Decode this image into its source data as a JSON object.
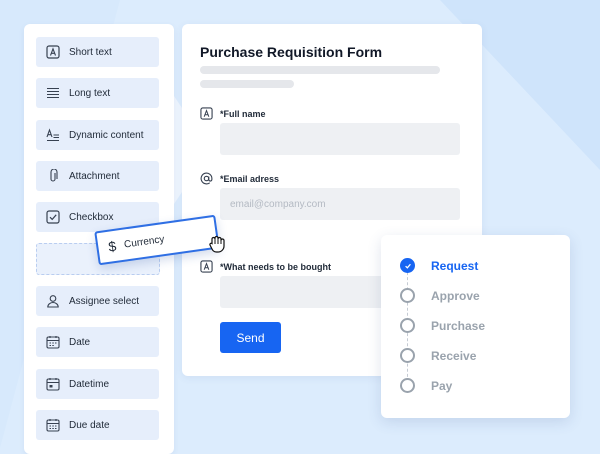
{
  "palette": {
    "items": [
      {
        "label": "Short text",
        "icon": "text-a-icon"
      },
      {
        "label": "Long text",
        "icon": "lines-icon"
      },
      {
        "label": "Dynamic content",
        "icon": "dynamic-text-icon"
      },
      {
        "label": "Attachment",
        "icon": "paperclip-icon"
      },
      {
        "label": "Checkbox",
        "icon": "checkbox-icon"
      },
      {
        "label": "Assignee select",
        "icon": "person-icon"
      },
      {
        "label": "Date",
        "icon": "calendar-icon"
      },
      {
        "label": "Datetime",
        "icon": "calendar-clock-icon"
      },
      {
        "label": "Due date",
        "icon": "calendar-due-icon"
      }
    ]
  },
  "drag": {
    "label": "Currency",
    "icon": "dollar-icon",
    "glyph": "$"
  },
  "form": {
    "title": "Purchase Requisition Form",
    "fields": [
      {
        "label": "*Full name",
        "icon": "text-a-icon",
        "value": "",
        "placeholder": ""
      },
      {
        "label": "*Email adress",
        "icon": "at-sign-icon",
        "value": "",
        "placeholder": "email@company.com"
      },
      {
        "label": "*What needs to be bought",
        "icon": "text-a-icon",
        "value": "",
        "placeholder": ""
      }
    ],
    "submit_label": "Send"
  },
  "workflow": {
    "steps": [
      {
        "label": "Request",
        "done": true
      },
      {
        "label": "Approve",
        "done": false
      },
      {
        "label": "Purchase",
        "done": false
      },
      {
        "label": "Receive",
        "done": false
      },
      {
        "label": "Pay",
        "done": false
      }
    ]
  },
  "colors": {
    "accent": "#1765f2",
    "background": "#dcecfd",
    "palette_item": "#e6eefb",
    "muted": "#9aa3ad"
  }
}
